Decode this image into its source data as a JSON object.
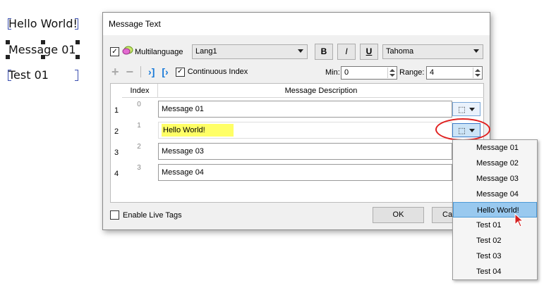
{
  "canvas": {
    "labels": [
      "Hello World!",
      "Message 01",
      "Test 01"
    ]
  },
  "dialog": {
    "title": "Message Text",
    "multilanguage_label": "Multilanguage",
    "language_value": "Lang1",
    "bold_label": "B",
    "italic_label": "I",
    "underline_label": "U",
    "font_value": "Tahoma",
    "continuous_index_label": "Continuous Index",
    "min_label": "Min:",
    "min_value": "0",
    "range_label": "Range:",
    "range_value": "4",
    "grid": {
      "col_index": "Index",
      "col_description": "Message Description",
      "rows": [
        {
          "num": "1",
          "index": "0",
          "text": "Message 01"
        },
        {
          "num": "2",
          "index": "1",
          "text": "Hello World!"
        },
        {
          "num": "3",
          "index": "2",
          "text": "Message 03"
        },
        {
          "num": "4",
          "index": "3",
          "text": "Message 04"
        }
      ]
    },
    "enable_live_tags_label": "Enable Live Tags",
    "ok_label": "OK",
    "cancel_label": "Ca"
  },
  "dropdown": {
    "items": [
      "Message 01",
      "Message 02",
      "Message 03",
      "Message 04",
      "Hello World!",
      "Test 01",
      "Test 02",
      "Test 03",
      "Test 04"
    ],
    "selected": "Hello World!"
  },
  "colors": {
    "highlight": "#ffff66",
    "selection": "#99c9ef",
    "accent_ring": "#e0201f"
  }
}
